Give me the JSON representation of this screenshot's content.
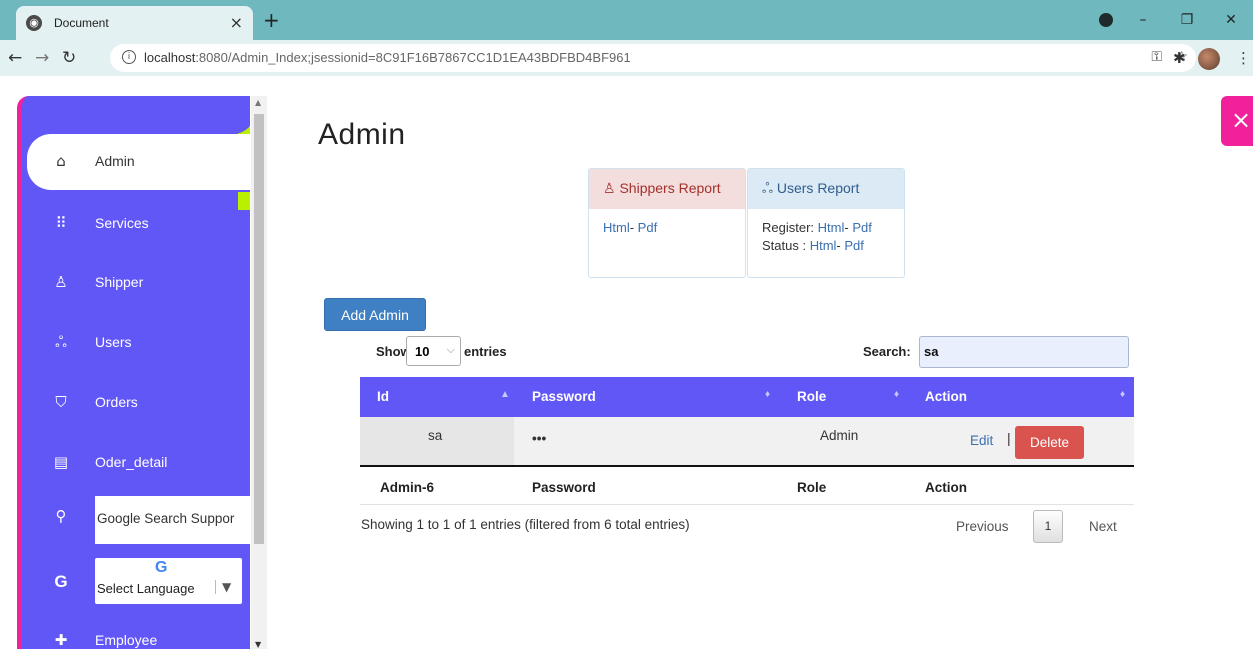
{
  "browser": {
    "tab_title": "Document",
    "url_main": "localhost",
    "url_rest": ":8080/Admin_Index;jsessionid=8C91F16B7867CC1D1EA43BDFBD4BF961"
  },
  "sidebar": {
    "items": [
      {
        "label": "Admin",
        "icon": "home-icon"
      },
      {
        "label": "Services",
        "icon": "grid-icon"
      },
      {
        "label": "Shipper",
        "icon": "person-icon"
      },
      {
        "label": "Users",
        "icon": "users-icon"
      },
      {
        "label": "Orders",
        "icon": "basket-icon"
      },
      {
        "label": "Oder_detail",
        "icon": "document-icon"
      }
    ],
    "search_text": "Google Search Suppor",
    "language_label": "Select Language",
    "google_g": "G",
    "employee_label": "Employee"
  },
  "main": {
    "title": "Admin",
    "cards": {
      "shippers": {
        "title": "Shippers Report",
        "html": "Html",
        "pdf": "Pdf"
      },
      "users": {
        "title": "Users Report",
        "register_label": "Register:",
        "status_label": "Status :",
        "html": "Html",
        "pdf": "Pdf"
      }
    },
    "add_button": "Add Admin",
    "show_label": "Show",
    "entries_value": "10",
    "entries_label": "entries",
    "search_label": "Search:",
    "search_value": "sa",
    "table": {
      "headers": [
        "Id",
        "Password",
        "Role",
        "Action"
      ],
      "rows": [
        {
          "id": "sa",
          "password": "•••",
          "role": "Admin",
          "edit": "Edit",
          "delete": "Delete"
        }
      ],
      "footer": [
        "Admin-6",
        "Password",
        "Role",
        "Action"
      ]
    },
    "info": "Showing 1 to 1 of 1 entries (filtered from 6 total entries)",
    "pagination": {
      "previous": "Previous",
      "page": "1",
      "next": "Next"
    }
  }
}
